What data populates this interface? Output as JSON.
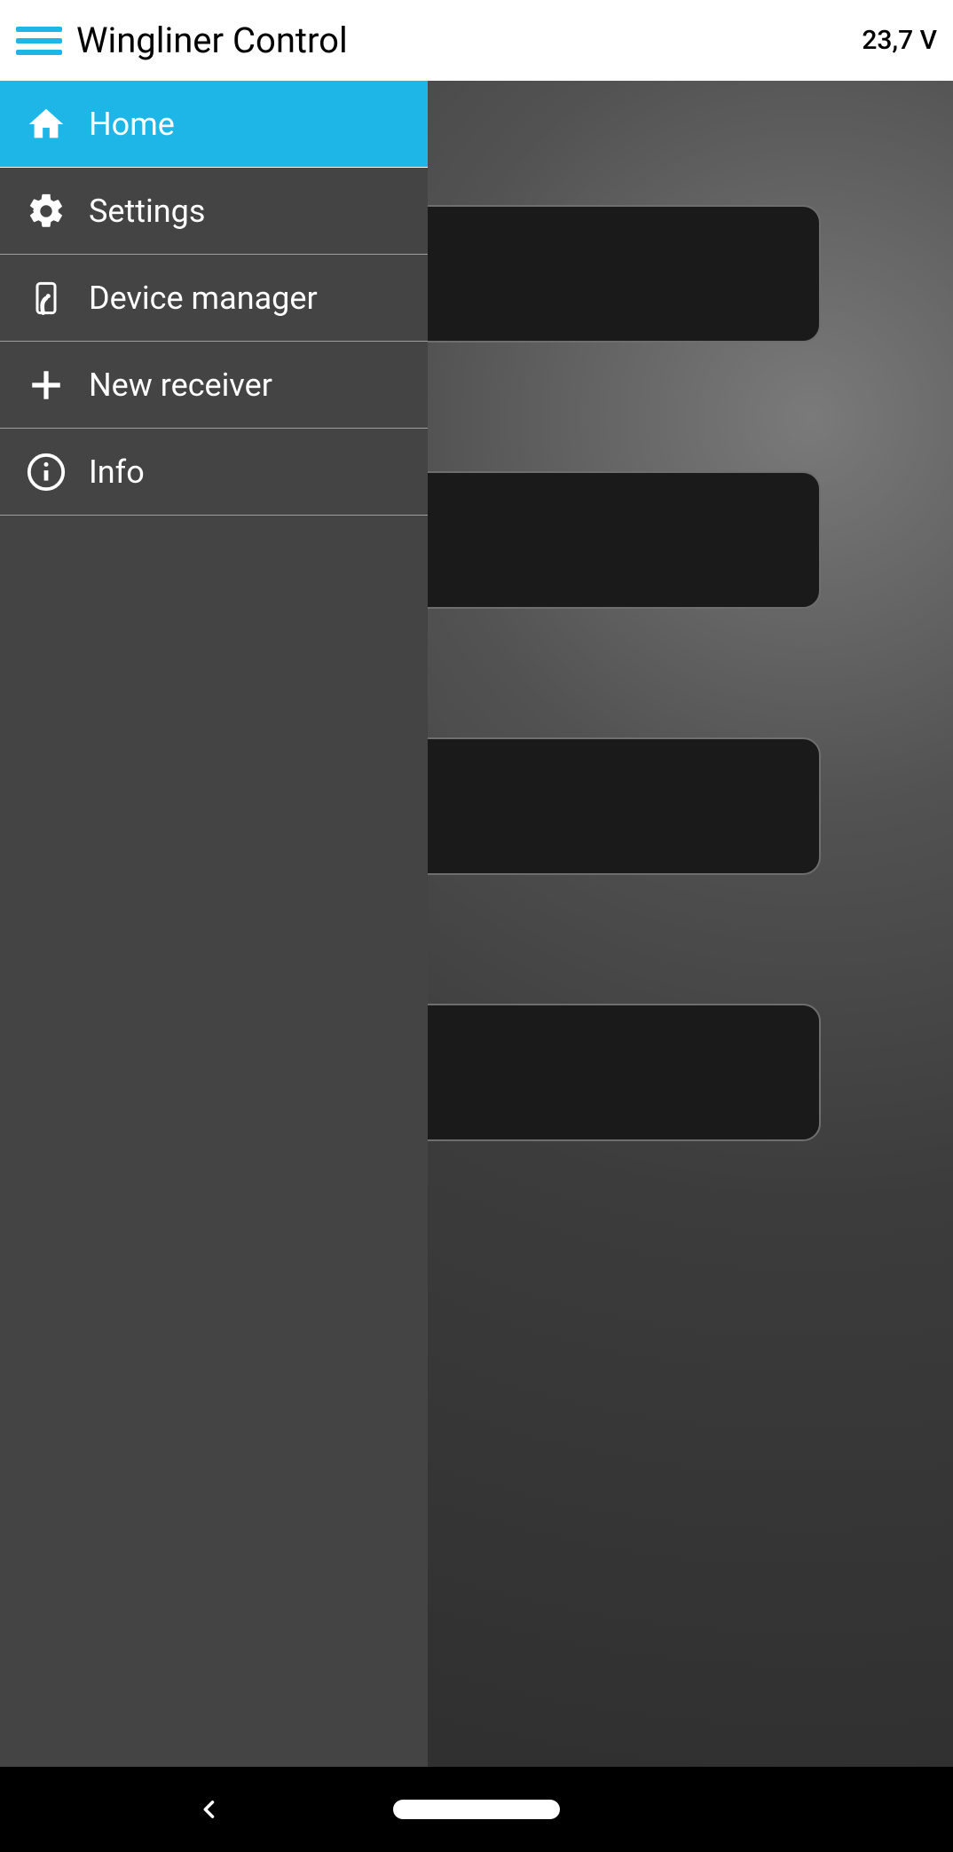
{
  "header": {
    "title": "Wingliner Control",
    "voltage": "23,7 V"
  },
  "drawer": {
    "items": [
      {
        "label": "Home",
        "icon": "home-icon",
        "active": true
      },
      {
        "label": "Settings",
        "icon": "gear-icon",
        "active": false
      },
      {
        "label": "Device manager",
        "icon": "device-icon",
        "active": false
      },
      {
        "label": "New receiver",
        "icon": "plus-icon",
        "active": false
      },
      {
        "label": "Info",
        "icon": "info-icon",
        "active": false
      }
    ]
  }
}
